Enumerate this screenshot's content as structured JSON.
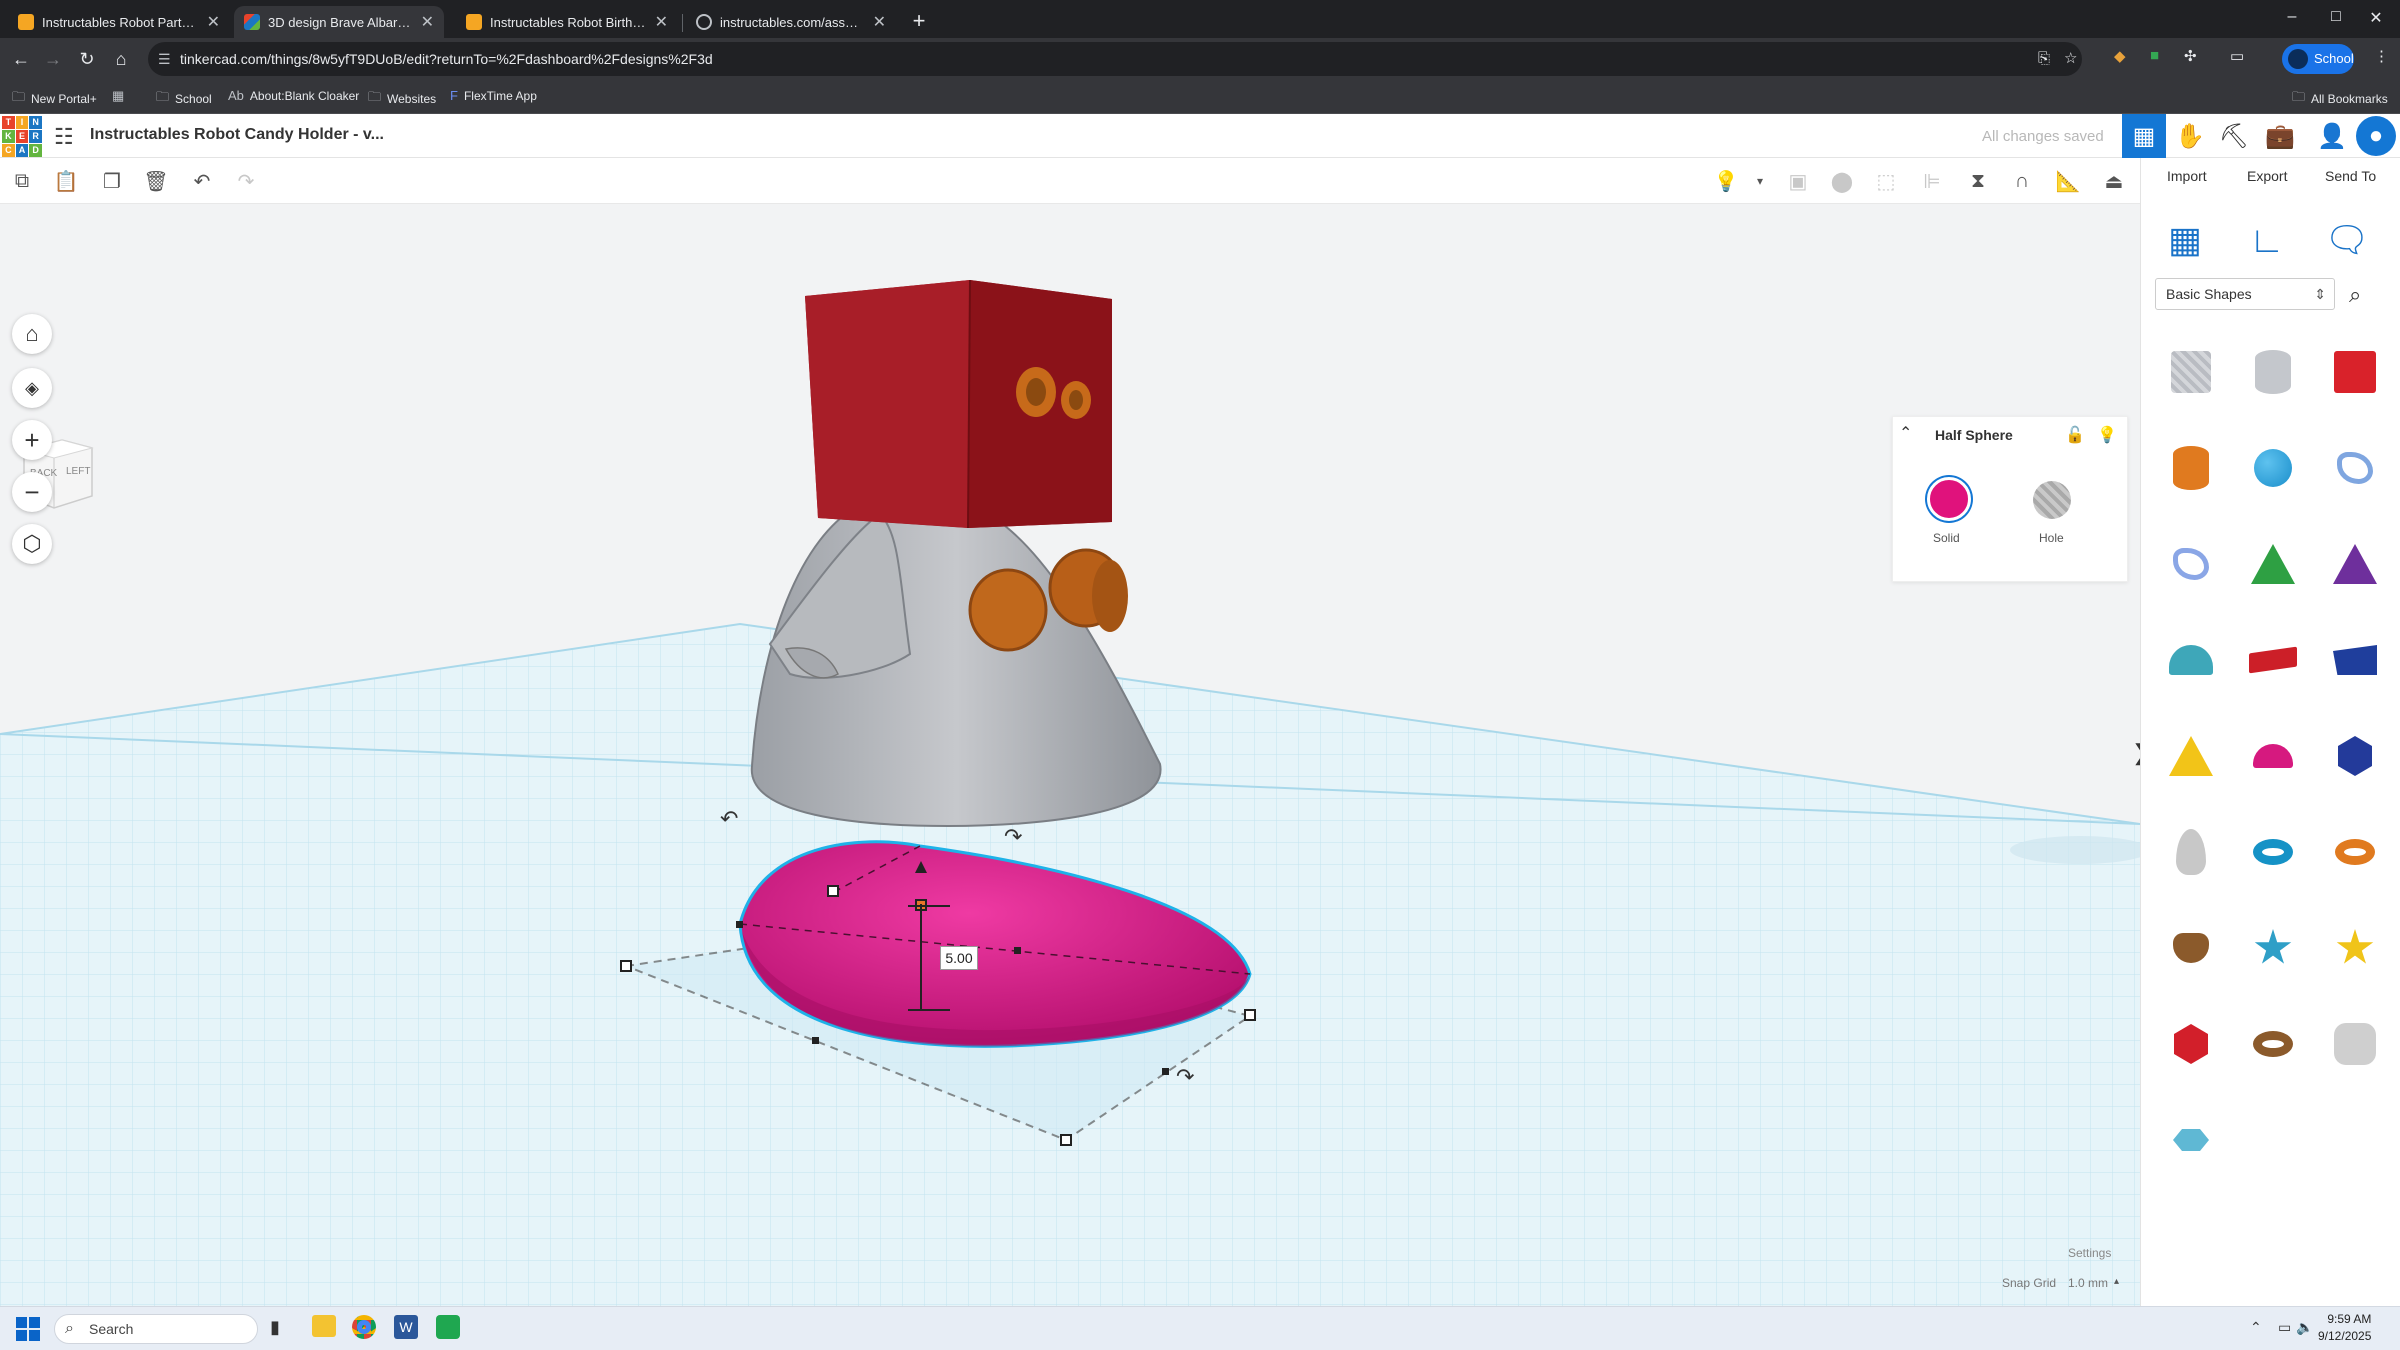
{
  "browser": {
    "tabs": [
      {
        "title": "Instructables Robot Party Hat - ...",
        "active": false,
        "favicon": "instructables-icon"
      },
      {
        "title": "3D design Brave Albar-Trug - Ti...",
        "active": true,
        "favicon": "tinkercad-icon"
      },
      {
        "title": "Instructables Robot Birthday Pa...",
        "active": false,
        "favicon": "instructables-icon"
      },
      {
        "title": "instructables.com/assets/img/i...",
        "active": false,
        "favicon": "globe-icon"
      }
    ],
    "new_tab": "+",
    "window_controls": [
      "–",
      "□",
      "✕"
    ],
    "url": "tinkercad.com/things/8w5yfT9DUoB/edit?returnTo=%2Fdashboard%2Fdesigns%2F3d",
    "profile_label": "School",
    "bookmarks": [
      {
        "label": "New Portal+",
        "icon": "folder-icon"
      },
      {
        "label": "",
        "icon": "apps-grid-icon"
      },
      {
        "label": "School",
        "icon": "folder-icon"
      },
      {
        "label": "About:Blank Cloaker",
        "icon": "ab-icon"
      },
      {
        "label": "Websites",
        "icon": "folder-icon"
      },
      {
        "label": "FlexTime App",
        "icon": "flextime-icon"
      }
    ],
    "all_bookmarks": "All Bookmarks"
  },
  "app": {
    "logo_letters": [
      "T",
      "I",
      "N",
      "K",
      "E",
      "R",
      "C",
      "A",
      "D"
    ],
    "logo_colors": [
      "#e8432b",
      "#f5a623",
      "#1b76c3",
      "#63b53f",
      "#e8432b",
      "#1b76c3",
      "#f5a623",
      "#1b76c3",
      "#63b53f"
    ],
    "design_title": "Instructables Robot Candy Holder - v...",
    "save_status": "All changes saved",
    "header_icons": [
      "grid-view-icon",
      "hand-wave-icon",
      "pickaxe-icon",
      "briefcase-icon",
      "add-user-icon",
      "profile-avatar-icon"
    ],
    "accent": "#1477d4"
  },
  "toolbar": {
    "left_tools": [
      "copy-icon",
      "paste-icon",
      "duplicate-icon",
      "delete-icon",
      "undo-icon",
      "redo-icon"
    ],
    "right_tools": [
      "light-bulb-icon",
      "dropdown-arrow-icon",
      "group-icon",
      "ungroup-icon",
      "cut-icon",
      "align-icon",
      "mirror-icon",
      "magnet-icon",
      "ruler-icon",
      "workplane-icon"
    ]
  },
  "right_panel": {
    "actions": [
      "Import",
      "Export",
      "Send To"
    ],
    "panel_icons": [
      "grid-panel-icon",
      "ruler-panel-icon",
      "notes-panel-icon"
    ],
    "category": "Basic Shapes",
    "shapes": [
      {
        "name": "box-hole",
        "color": "#b9bcc2"
      },
      {
        "name": "cylinder-hole",
        "color": "#c4c7cc"
      },
      {
        "name": "box",
        "color": "#d9222a"
      },
      {
        "name": "cylinder",
        "color": "#e07a1f"
      },
      {
        "name": "sphere",
        "color": "#1a8ecb"
      },
      {
        "name": "scribble",
        "color": "#7fa6e0"
      },
      {
        "name": "graphic",
        "color": "#8aa6e6"
      },
      {
        "name": "roof",
        "color": "#2ea043"
      },
      {
        "name": "cone",
        "color": "#6e2f9c"
      },
      {
        "name": "round-roof",
        "color": "#3ea7b9"
      },
      {
        "name": "text",
        "color": "#cc1f28"
      },
      {
        "name": "wedge",
        "color": "#1f3e9c"
      },
      {
        "name": "pyramid",
        "color": "#f2c418"
      },
      {
        "name": "half-sphere",
        "color": "#d6197f"
      },
      {
        "name": "polygon",
        "color": "#233a9a"
      },
      {
        "name": "paraboloid",
        "color": "#c8c8c8"
      },
      {
        "name": "torus",
        "color": "#1592c6"
      },
      {
        "name": "tube",
        "color": "#e07a1f"
      },
      {
        "name": "heart",
        "color": "#8b5a2b"
      },
      {
        "name": "star",
        "color": "#2f9fc7"
      },
      {
        "name": "star-yellow",
        "color": "#f0c419"
      },
      {
        "name": "icosahedron",
        "color": "#d21f2a"
      },
      {
        "name": "ring",
        "color": "#8b5a2b"
      },
      {
        "name": "round-box",
        "color": "#cfcfcf"
      },
      {
        "name": "hexagon-prism",
        "color": "#5fb8d4"
      }
    ]
  },
  "inspector": {
    "shape_name": "Half Sphere",
    "solid_label": "Solid",
    "hole_label": "Hole",
    "solid_color": "#e0127c"
  },
  "view_cube": {
    "back": "BACK",
    "left": "LEFT"
  },
  "view_controls": [
    "home-view-icon",
    "fit-view-icon",
    "zoom-in-icon",
    "zoom-out-icon",
    "perspective-icon"
  ],
  "scene": {
    "dimension_label": "5.00",
    "selected_color": "#d8178a"
  },
  "workplane_footer": {
    "settings": "Settings",
    "snap_grid_label": "Snap Grid",
    "snap_grid_value": "1.0 mm"
  },
  "taskbar": {
    "search_placeholder": "Search",
    "time": "9:59 AM",
    "date": "9/12/2025"
  }
}
